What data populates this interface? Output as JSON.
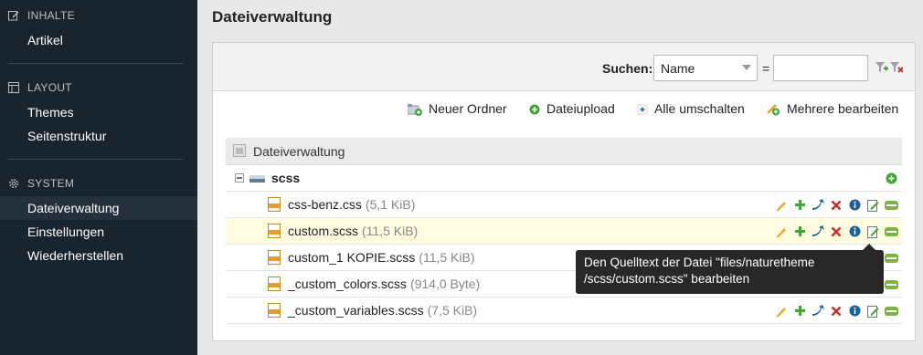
{
  "sidebar": {
    "sections": [
      {
        "title": "INHALTE",
        "icon": "edit-icon",
        "items": [
          {
            "label": "Artikel",
            "active": false
          }
        ]
      },
      {
        "title": "LAYOUT",
        "icon": "layout-icon",
        "items": [
          {
            "label": "Themes",
            "active": false
          },
          {
            "label": "Seitenstruktur",
            "active": false
          }
        ]
      },
      {
        "title": "SYSTEM",
        "icon": "gear-icon",
        "items": [
          {
            "label": "Dateiverwaltung",
            "active": true
          },
          {
            "label": "Einstellungen",
            "active": false
          },
          {
            "label": "Wiederherstellen",
            "active": false
          }
        ]
      }
    ]
  },
  "page": {
    "title": "Dateiverwaltung"
  },
  "filter": {
    "label": "Suchen:",
    "select_value": "Name",
    "equals": "=",
    "input_value": ""
  },
  "toolbar": {
    "new_folder": "Neuer Ordner",
    "upload": "Dateiupload",
    "toggle_all": "Alle umschalten",
    "edit_multiple": "Mehrere bearbeiten"
  },
  "tree": {
    "header": "Dateiverwaltung",
    "folder": "scss",
    "files": [
      {
        "name": "css-benz.css",
        "size": "(5,1 KiB)",
        "highlight": false
      },
      {
        "name": "custom.scss",
        "size": "(11,5 KiB)",
        "highlight": true
      },
      {
        "name": "custom_1 KOPIE.scss",
        "size": "(11,5 KiB)",
        "highlight": false
      },
      {
        "name": "_custom_colors.scss",
        "size": "(914,0 Byte)",
        "highlight": false
      },
      {
        "name": "_custom_variables.scss",
        "size": "(7,5 KiB)",
        "highlight": false
      }
    ]
  },
  "tooltip": {
    "line1": "Den Quelltext der Datei \"files/naturetheme",
    "line2": "/scss/custom.scss\" bearbeiten"
  },
  "colors": {
    "sidebar_bg": "#18242e",
    "highlight_row": "#fffbe1",
    "add_green": "#3fa535",
    "delete_red": "#c9302c",
    "info_blue": "#1f5f93"
  }
}
